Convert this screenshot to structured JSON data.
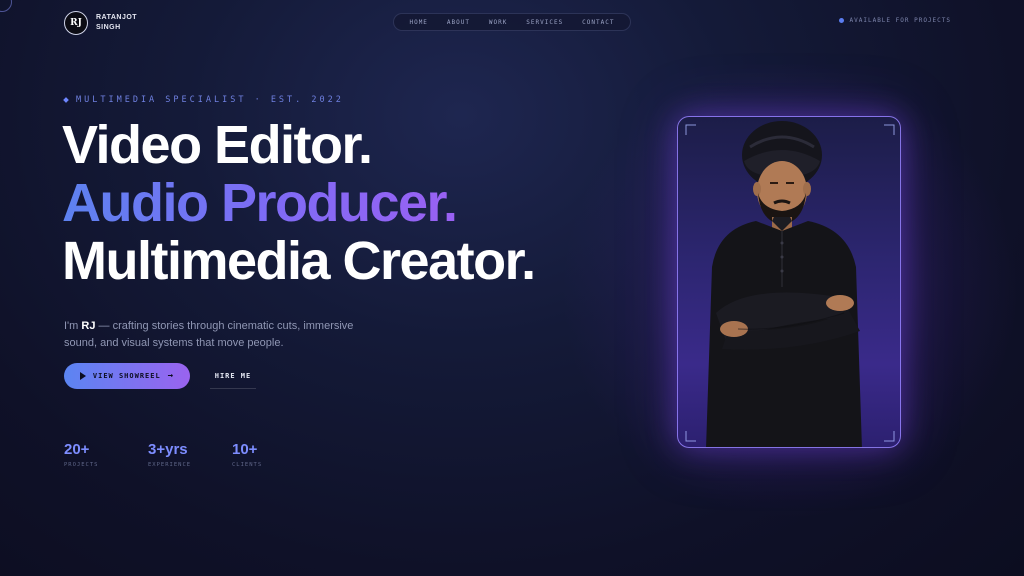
{
  "brand": {
    "initials": "RJ",
    "name": "RATANJOT SINGH"
  },
  "nav": {
    "items": [
      "HOME",
      "ABOUT",
      "WORK",
      "SERVICES",
      "CONTACT"
    ]
  },
  "status": {
    "text": "AVAILABLE FOR PROJECTS",
    "color": "#5b7df0"
  },
  "hero": {
    "eyebrow": "MULTIMEDIA SPECIALIST · EST. 2022",
    "headline": [
      "Video Editor.",
      "Audio Producer.",
      "Multimedia Creator."
    ],
    "tagline_prefix": "I'm ",
    "tagline_name": "RJ",
    "tagline_rest": " — crafting stories through cinematic cuts, immersive sound, and visual systems that move people.",
    "primary_cta": "VIEW SHOWREEL",
    "secondary_cta": "HIRE ME"
  },
  "stats": [
    {
      "value": "20+",
      "label": "PROJECTS"
    },
    {
      "value": "3+yrs",
      "label": "EXPERIENCE"
    },
    {
      "value": "10+",
      "label": "CLIENTS"
    }
  ],
  "colors": {
    "accent_blue": "#5d82f0",
    "accent_purple": "#a55cf2",
    "background": "#0f1128"
  },
  "portrait": {
    "icon": "portrait-illustration"
  }
}
